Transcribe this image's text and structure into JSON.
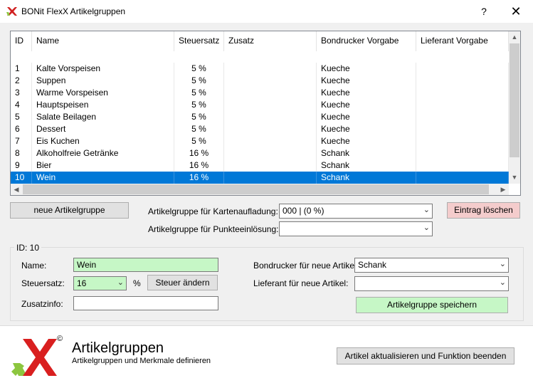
{
  "window": {
    "title": "BONit FlexX Artikelgruppen",
    "help": "?",
    "close": "✕"
  },
  "grid": {
    "columns": {
      "id": "ID",
      "name": "Name",
      "tax": "Steuersatz",
      "extra": "Zusatz",
      "printer": "Bondrucker Vorgabe",
      "supplier": "Lieferant Vorgabe"
    },
    "rows": [
      {
        "id": "1",
        "name": "Kalte Vorspeisen",
        "tax": "5 %",
        "extra": "",
        "printer": "Kueche",
        "supplier": ""
      },
      {
        "id": "2",
        "name": "Suppen",
        "tax": "5 %",
        "extra": "",
        "printer": "Kueche",
        "supplier": ""
      },
      {
        "id": "3",
        "name": "Warme Vorspeisen",
        "tax": "5 %",
        "extra": "",
        "printer": "Kueche",
        "supplier": ""
      },
      {
        "id": "4",
        "name": "Hauptspeisen",
        "tax": "5 %",
        "extra": "",
        "printer": "Kueche",
        "supplier": ""
      },
      {
        "id": "5",
        "name": "Salate Beilagen",
        "tax": "5 %",
        "extra": "",
        "printer": "Kueche",
        "supplier": ""
      },
      {
        "id": "6",
        "name": "Dessert",
        "tax": "5 %",
        "extra": "",
        "printer": "Kueche",
        "supplier": ""
      },
      {
        "id": "7",
        "name": "Eis Kuchen",
        "tax": "5 %",
        "extra": "",
        "printer": "Kueche",
        "supplier": ""
      },
      {
        "id": "8",
        "name": "Alkoholfreie Getränke",
        "tax": "16 %",
        "extra": "",
        "printer": "Schank",
        "supplier": ""
      },
      {
        "id": "9",
        "name": "Bier",
        "tax": "16 %",
        "extra": "",
        "printer": "Schank",
        "supplier": ""
      },
      {
        "id": "10",
        "name": "Wein",
        "tax": "16 %",
        "extra": "",
        "printer": "Schank",
        "supplier": ""
      }
    ],
    "selected_row": "10",
    "selection_color": "#0078d7"
  },
  "actions": {
    "new_group": "neue Artikelgruppe",
    "delete_entry": "Eintrag löschen",
    "delete_color": "#f4cccc"
  },
  "card_group": {
    "label": "Artikelgruppe für Kartenaufladung:",
    "value": "000 |  (0 %)"
  },
  "points_group": {
    "label": "Artikelgruppe für Punkteeinlösung:",
    "value": ""
  },
  "detail": {
    "id_label": "ID: 10",
    "name_label": "Name:",
    "name_value": "Wein",
    "tax_label": "Steuersatz:",
    "tax_value": "16",
    "percent": "%",
    "change_tax": "Steuer ändern",
    "extra_label": "Zusatzinfo:",
    "extra_value": "",
    "printer_label": "Bondrucker für neue Artikel:",
    "printer_value": "Schank",
    "supplier_label": "Lieferant für neue Artikel:",
    "supplier_value": "",
    "save": "Artikelgruppe speichern",
    "highlight_color": "#c6f7c6"
  },
  "footer": {
    "logo_mark": "©",
    "title": "Artikelgruppen",
    "subtitle": "Artikelgruppen und Merkmale definieren",
    "finish": "Artikel aktualisieren und Funktion beenden"
  }
}
